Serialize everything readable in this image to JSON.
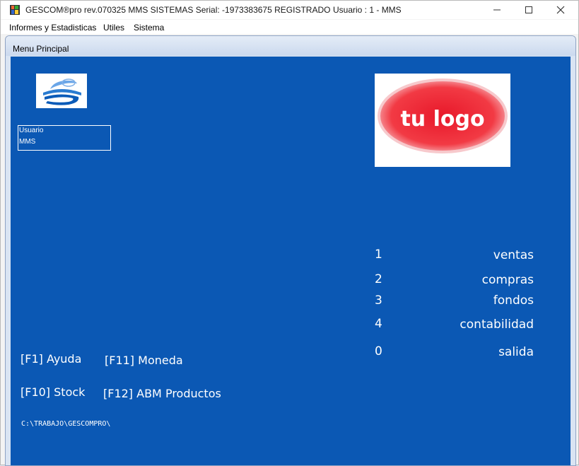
{
  "window": {
    "title": "GESCOM®pro rev.070325 MMS SISTEMAS Serial: -1973383675 REGISTRADO",
    "user_info": "Usuario : 1 - MMS",
    "controls": {
      "minimize_icon": "minimize-icon",
      "maximize_icon": "maximize-icon",
      "close_icon": "close-icon"
    }
  },
  "menubar": {
    "items": [
      {
        "label": "Informes y Estadisticas"
      },
      {
        "label": "Utiles"
      },
      {
        "label": "Sistema"
      }
    ]
  },
  "child_window": {
    "title": "Menu Principal"
  },
  "user_box": {
    "label": "Usuario",
    "value": "MMS"
  },
  "company_logo": {
    "text": "tu logo"
  },
  "options": [
    {
      "key": "1",
      "label": "ventas"
    },
    {
      "key": "2",
      "label": "compras"
    },
    {
      "key": "3",
      "label": "fondos"
    },
    {
      "key": "4",
      "label": "contabilidad"
    },
    {
      "key": "0",
      "label": "salida"
    }
  ],
  "function_keys": {
    "f1": "[F1] Ayuda",
    "f11": "[F11] Moneda",
    "f10": "[F10] Stock",
    "f12": "[F12] ABM Productos"
  },
  "status": {
    "path": "C:\\TRABAJO\\GESCOMPRO\\"
  },
  "colors": {
    "client_background": "#0b58b4",
    "logo_red": "#ee2233",
    "text": "#ffffff"
  }
}
